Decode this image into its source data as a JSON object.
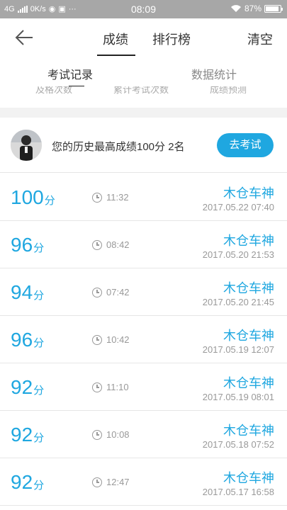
{
  "status_bar": {
    "network": "4G",
    "speed": "0K/s",
    "more": "···",
    "time": "08:09",
    "battery": "87%"
  },
  "nav": {
    "tab_score": "成绩",
    "tab_rank": "排行榜",
    "clear": "清空"
  },
  "sub_tabs": {
    "records": "考试记录",
    "stats": "数据统计"
  },
  "hidden_labels": [
    "及格次数",
    "累计考试次数",
    "成绩预测"
  ],
  "profile": {
    "summary": "您的历史最高成绩100分  2名",
    "button": "去考试"
  },
  "score_unit": "分",
  "records": [
    {
      "score": "100",
      "duration": "11:32",
      "name": "木仓车神",
      "date": "2017.05.22  07:40"
    },
    {
      "score": "96",
      "duration": "08:42",
      "name": "木仓车神",
      "date": "2017.05.20  21:53"
    },
    {
      "score": "94",
      "duration": "07:42",
      "name": "木仓车神",
      "date": "2017.05.20  21:45"
    },
    {
      "score": "96",
      "duration": "10:42",
      "name": "木仓车神",
      "date": "2017.05.19  12:07"
    },
    {
      "score": "92",
      "duration": "11:10",
      "name": "木仓车神",
      "date": "2017.05.19  08:01"
    },
    {
      "score": "92",
      "duration": "10:08",
      "name": "木仓车神",
      "date": "2017.05.18  07:52"
    },
    {
      "score": "92",
      "duration": "12:47",
      "name": "木仓车神",
      "date": "2017.05.17  16:58"
    }
  ]
}
